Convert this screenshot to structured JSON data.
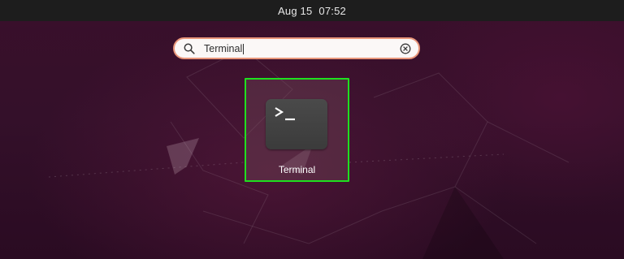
{
  "top_bar": {
    "date": "Aug 15",
    "time": "07:52"
  },
  "search": {
    "query": "Terminal",
    "icon": "search-icon",
    "clear_icon": "clear-icon"
  },
  "results": [
    {
      "label": "Terminal",
      "icon": "terminal-icon",
      "prompt_glyph": ">_"
    }
  ],
  "colors": {
    "top_bar": "#1d1d1d",
    "wallpaper": "#3a0f2b",
    "search_border": "#e9967a",
    "highlight_border": "#1fe01f",
    "icon_bg": "#444444"
  }
}
